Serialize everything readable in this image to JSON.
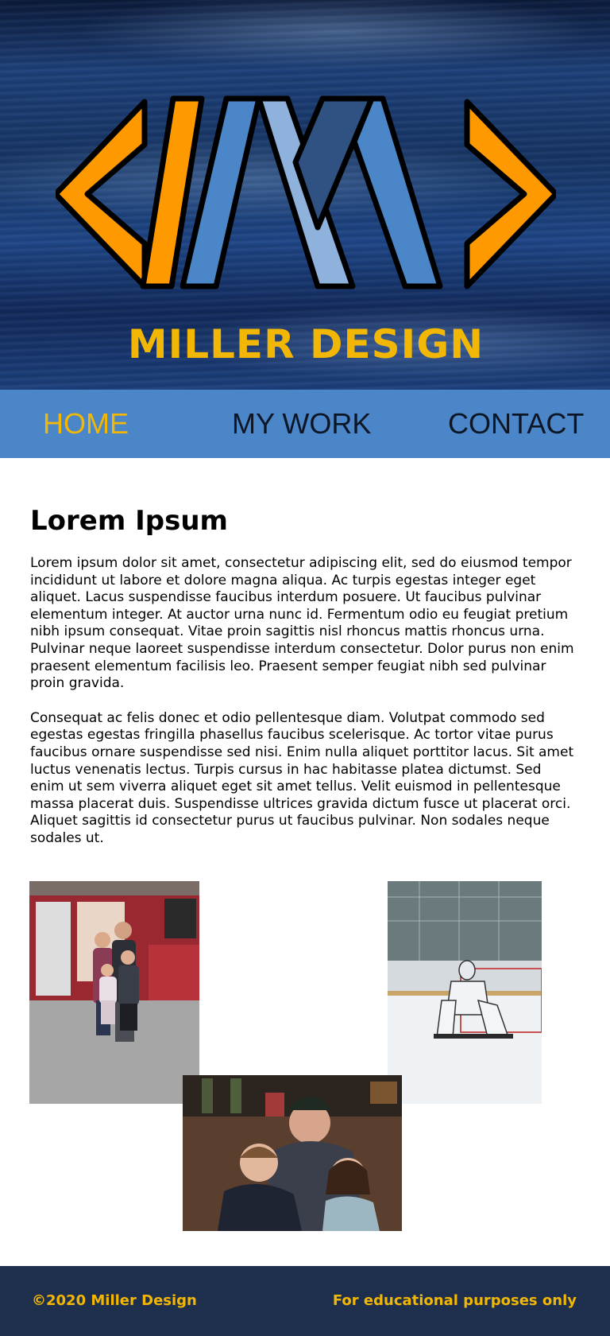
{
  "brand": {
    "name": "MILLER DESIGN",
    "colors": {
      "accent": "#f2b705",
      "nav_bg": "#4a86c8",
      "footer_bg": "#1e2e4d",
      "logo_orange": "#ff9900",
      "logo_blue": "#4a86c8"
    }
  },
  "nav": {
    "items": [
      {
        "label": "HOME",
        "active": true
      },
      {
        "label": "MY WORK",
        "active": false
      },
      {
        "label": "CONTACT",
        "active": false
      }
    ]
  },
  "main": {
    "heading": "Lorem Ipsum",
    "paragraphs": [
      "Lorem ipsum dolor sit amet, consectetur adipiscing elit, sed do eiusmod tempor incididunt ut labore et dolore magna aliqua. Ac turpis egestas integer eget aliquet. Lacus suspendisse faucibus interdum posuere. Ut faucibus pulvinar elementum integer. At auctor urna nunc id. Fermentum odio eu feugiat pretium nibh ipsum consequat. Vitae proin sagittis nisl rhoncus mattis rhoncus urna. Pulvinar neque laoreet suspendisse interdum consectetur. Dolor purus non enim praesent elementum facilisis leo. Praesent semper feugiat nibh sed pulvinar proin gravida.",
      "Consequat ac felis donec et odio pellentesque diam. Volutpat commodo sed egestas egestas fringilla phasellus faucibus scelerisque. Ac tortor vitae purus faucibus ornare suspendisse sed nisi. Enim nulla aliquet porttitor lacus. Sit amet luctus venenatis lectus. Turpis cursus in hac habitasse platea dictumst. Sed enim ut sem viverra aliquet eget sit amet tellus. Velit euismod in pellentesque massa placerat duis. Suspendisse ultrices gravida dictum fusce ut placerat orci. Aliquet sagittis id consectetur purus ut faucibus pulvinar. Non sodales neque sodales ut."
    ]
  },
  "footer": {
    "copyright": "©2020 Miller Design",
    "note": "For educational purposes only"
  }
}
